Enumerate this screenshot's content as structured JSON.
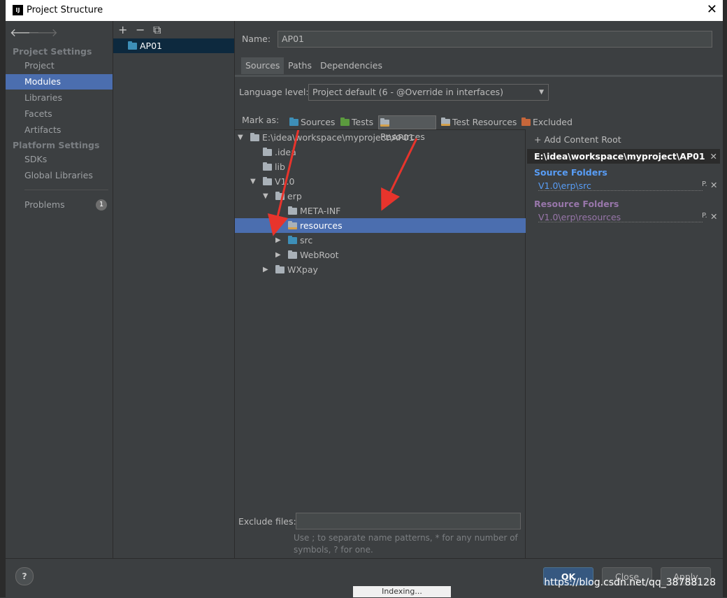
{
  "window": {
    "title": "Project Structure",
    "logo": "IJ",
    "close_glyph": "✕"
  },
  "nav": {
    "back": "🡐",
    "forward": "🡒",
    "project_settings_header": "Project Settings",
    "platform_settings_header": "Platform Settings",
    "items": [
      {
        "label": "Project"
      },
      {
        "label": "Modules"
      },
      {
        "label": "Libraries"
      },
      {
        "label": "Facets"
      },
      {
        "label": "Artifacts"
      },
      {
        "label": "SDKs"
      },
      {
        "label": "Global Libraries"
      },
      {
        "label": "Problems",
        "badge": "1"
      }
    ]
  },
  "modules": {
    "toolbar": {
      "add": "+",
      "remove": "−",
      "copy": "⧉"
    },
    "selected": "AP01"
  },
  "main": {
    "name_label": "Name:",
    "name_value": "AP01",
    "tabs": [
      {
        "label": "Sources"
      },
      {
        "label": "Paths"
      },
      {
        "label": "Dependencies"
      }
    ],
    "language_label": "Language level:",
    "language_value": "Project default (6 - @Override in interfaces)",
    "mark_as_label": "Mark as:",
    "mark_as": [
      {
        "label": "Sources",
        "color": "#3d8fb8"
      },
      {
        "label": "Tests",
        "color": "#5b9a3e"
      },
      {
        "label": "Resources",
        "color": "#a9b1b8"
      },
      {
        "label": "Test Resources",
        "color": "#a9b1b8"
      },
      {
        "label": "Excluded",
        "color": "#c6663a"
      }
    ],
    "tree": [
      {
        "label": "E:\\idea\\workspace\\myproject\\AP01"
      },
      {
        "label": ".idea"
      },
      {
        "label": "lib"
      },
      {
        "label": "V1.0"
      },
      {
        "label": "erp"
      },
      {
        "label": "META-INF"
      },
      {
        "label": "resources"
      },
      {
        "label": "src"
      },
      {
        "label": "WebRoot"
      },
      {
        "label": "WXpay"
      }
    ],
    "exclude_label": "Exclude files:",
    "exclude_value": "",
    "exclude_hint_1": "Use ; to separate name patterns, * for any number of",
    "exclude_hint_2": "symbols, ? for one."
  },
  "content_root": {
    "add_label": "+ Add Content Root",
    "root_path": "E:\\idea\\workspace\\myproject\\AP01",
    "source_header": "Source Folders",
    "source_path": "V1.0\\erp\\src",
    "resource_header": "Resource Folders",
    "resource_path": "V1.0\\erp\\resources",
    "source_color": "#589df6",
    "resource_color": "#9876aa"
  },
  "footer": {
    "help": "?",
    "ok": "OK",
    "close": "Close",
    "apply": "Apply",
    "watermark": "https://blog.csdn.net/qq_38788128",
    "indexing": "Indexing..."
  }
}
